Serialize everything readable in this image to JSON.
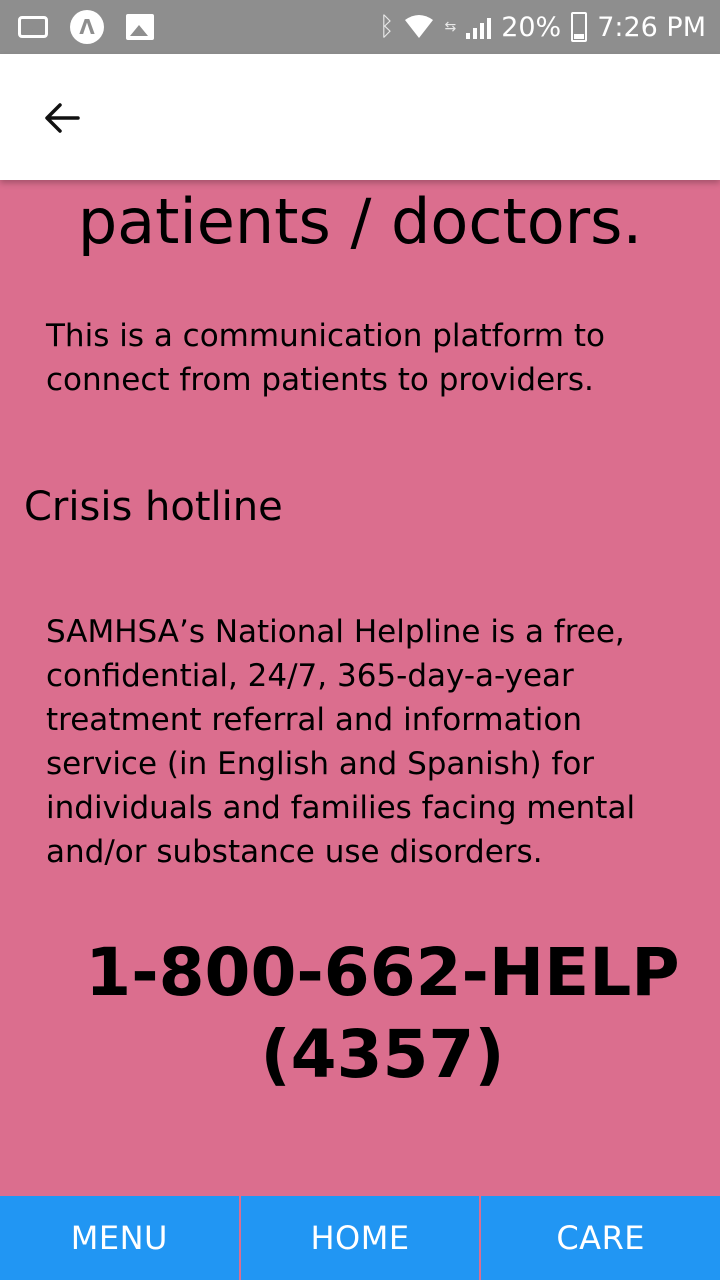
{
  "status_bar": {
    "battery": "20%",
    "time": "7:26 PM",
    "icons": [
      "voicemail-icon",
      "app-a-icon",
      "image-icon",
      "bluetooth-icon",
      "wifi-icon",
      "data-icon",
      "signal-icon",
      "battery-icon"
    ]
  },
  "app_bar": {
    "back_icon": "arrow-left-icon"
  },
  "content": {
    "heading": "patients / doctors.",
    "intro": "This is a communication platform to connect from patients to providers.",
    "section_title": "Crisis hotline",
    "description": "SAMHSA’s National Helpline is a free, confidential, 24/7, 365-day-a-year treatment referral and information service (in English and Spanish) for individuals and families facing mental and/or substance use disorders.",
    "phone_line1": "1-800-662-HELP",
    "phone_line2": "(4357)"
  },
  "bottom_nav": {
    "menu": "MENU",
    "home": "HOME",
    "care": "CARE"
  },
  "colors": {
    "background": "#DB6E8E",
    "status_bar": "#8E8E8E",
    "nav_button": "#2196F3"
  }
}
